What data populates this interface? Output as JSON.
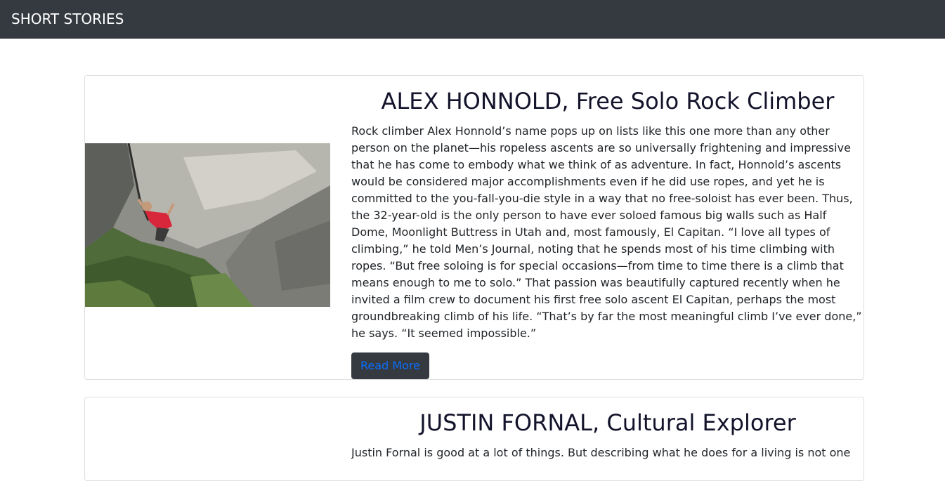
{
  "navbar": {
    "brand": "SHORT STORIES"
  },
  "stories": [
    {
      "title": "ALEX HONNOLD, Free Solo Rock Climber",
      "text": "Rock climber Alex Honnold’s name pops up on lists like this one more than any other person on the planet—his ropeless ascents are so universally frightening and impressive that he has come to embody what we think of as adventure. In fact, Honnold’s ascents would be considered major accomplishments even if he did use ropes, and yet he is committed to the you-fall-you-die style in a way that no free-soloist has ever been. Thus, the 32-year-old is the only person to have ever soloed famous big walls such as Half Dome, Moonlight Buttress in Utah and, most famously, El Capitan. “I love all types of climbing,” he told Men’s Journal, noting that he spends most of his time climbing with ropes. “But free soloing is for special occasions—from time to time there is a climb that means enough to me to solo.” That passion was beautifully captured recently when he invited a film crew to document his first free solo ascent El Capitan, perhaps the most groundbreaking climb of his life. “That’s by far the most meaningful climb I’ve ever done,” he says. “It seemed impossible.”",
      "button_label": "Read More"
    },
    {
      "title": "JUSTIN FORNAL, Cultural Explorer",
      "text": "Justin Fornal is good at a lot of things. But describing what he does for a living is not one"
    }
  ],
  "colors": {
    "navbar_bg": "#343a40",
    "button_bg": "#343a40",
    "button_text": "#0d6efd",
    "title_text": "#13132b"
  }
}
